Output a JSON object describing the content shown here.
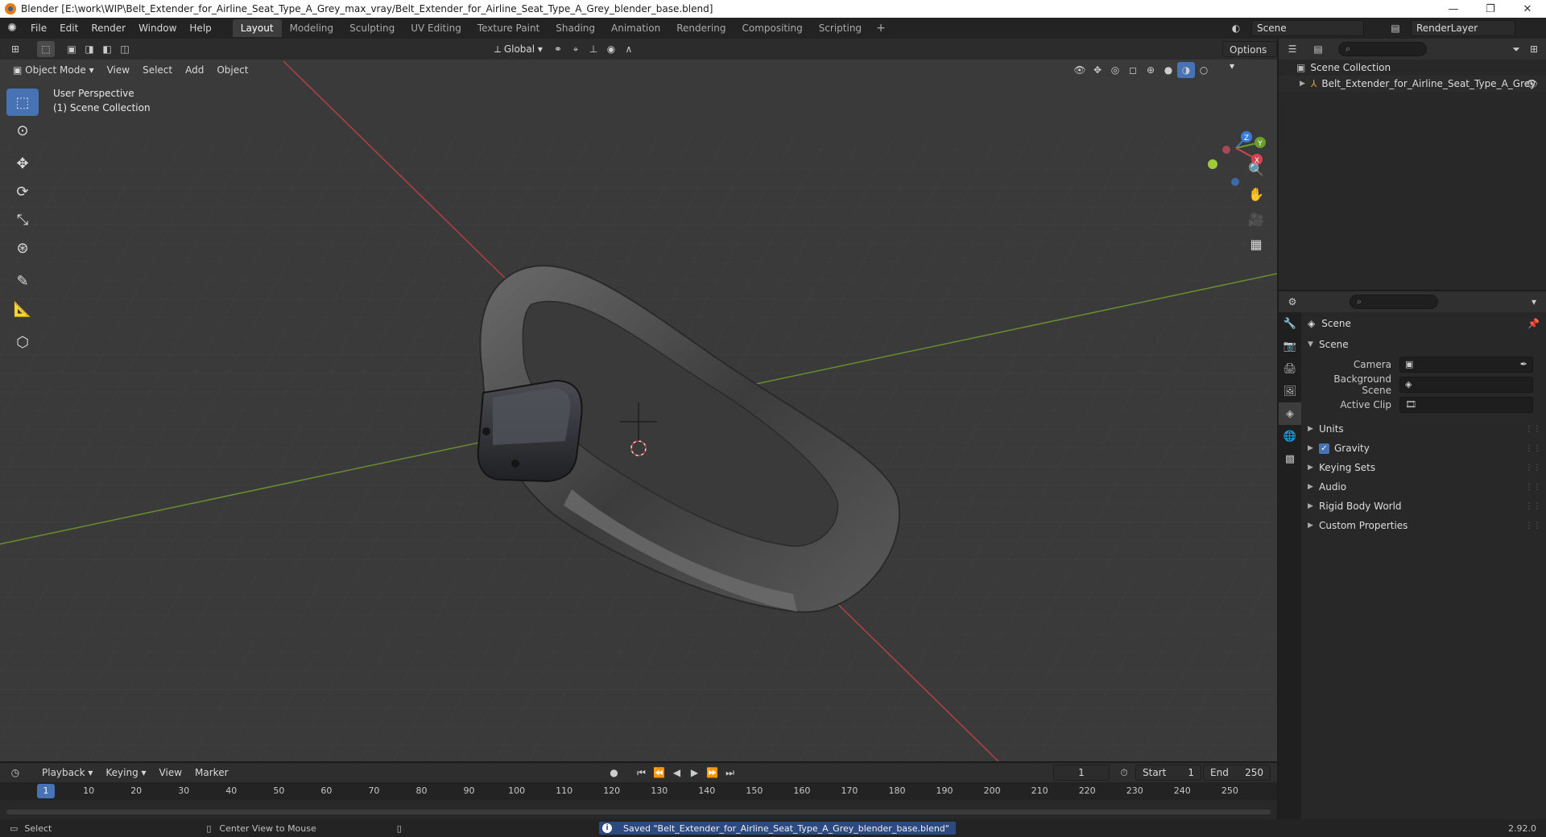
{
  "window": {
    "title": "Blender [E:\\work\\WIP\\Belt_Extender_for_Airline_Seat_Type_A_Grey_max_vray/Belt_Extender_for_Airline_Seat_Type_A_Grey_blender_base.blend]",
    "minimize": "—",
    "restore": "❐",
    "close": "✕"
  },
  "menu": [
    "File",
    "Edit",
    "Render",
    "Window",
    "Help"
  ],
  "workspaces": [
    "Layout",
    "Modeling",
    "Sculpting",
    "UV Editing",
    "Texture Paint",
    "Shading",
    "Animation",
    "Rendering",
    "Compositing",
    "Scripting"
  ],
  "active_workspace": "Layout",
  "scene_name": "Scene",
  "view_layer": "RenderLayer",
  "viewport": {
    "transform_orientation": "Global",
    "options_label": "Options",
    "mode": "Object Mode",
    "header_menu": [
      "View",
      "Select",
      "Add",
      "Object"
    ],
    "perspective_label": "User Perspective",
    "collection_label": "(1) Scene Collection",
    "gizmo_axes": {
      "x": "X",
      "y": "Y",
      "z": "Z"
    }
  },
  "outliner": {
    "root": "Scene Collection",
    "object": "Belt_Extender_for_Airline_Seat_Type_A_Grey"
  },
  "properties": {
    "context_title": "Scene",
    "section_title": "Scene",
    "fields": [
      {
        "label": "Camera"
      },
      {
        "label": "Background Scene"
      },
      {
        "label": "Active Clip"
      }
    ],
    "subsections": [
      "Units",
      "Gravity",
      "Keying Sets",
      "Audio",
      "Rigid Body World",
      "Custom Properties"
    ],
    "gravity_checked": true
  },
  "timeline": {
    "menu": [
      "Playback",
      "Keying",
      "View",
      "Marker"
    ],
    "current_frame": "1",
    "start_label": "Start",
    "start_value": "1",
    "end_label": "End",
    "end_value": "250",
    "ticks": [
      "10",
      "20",
      "30",
      "40",
      "50",
      "60",
      "70",
      "80",
      "90",
      "100",
      "110",
      "120",
      "130",
      "140",
      "150",
      "160",
      "170",
      "180",
      "190",
      "200",
      "210",
      "220",
      "230",
      "240",
      "250"
    ]
  },
  "statusbar": {
    "left_action": "Select",
    "mid_action": "Center View to Mouse",
    "message": "Saved \"Belt_Extender_for_Airline_Seat_Type_A_Grey_blender_base.blend\"",
    "version": "2.92.0"
  },
  "colors": {
    "accent": "#4772b3",
    "axis_x": "#d7424f",
    "axis_y": "#6a9e2a",
    "axis_z": "#3b7bd9"
  }
}
